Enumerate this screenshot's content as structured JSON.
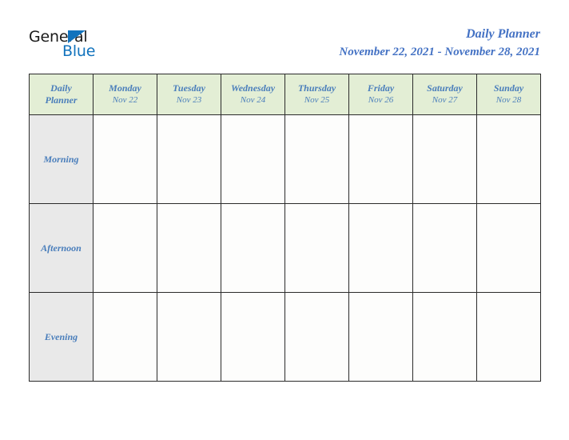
{
  "logo": {
    "word_one": "General",
    "word_two": "Blue",
    "triangle_icon": "triangle-icon",
    "word_one_color": "#1a1a1a",
    "word_two_color": "#1273bd"
  },
  "header": {
    "title": "Daily Planner",
    "date_range": "November 22, 2021 - November 28, 2021",
    "title_color": "#4472c4"
  },
  "table": {
    "corner_label_line1": "Daily",
    "corner_label_line2": "Planner",
    "header_bg": "#e3eed5",
    "row_label_bg": "#e9e9e9",
    "cell_bg": "#fdfdfc",
    "border_color": "#2b2b2b",
    "text_color": "#4a7ebb",
    "columns": [
      {
        "day": "Monday",
        "date": "Nov 22"
      },
      {
        "day": "Tuesday",
        "date": "Nov 23"
      },
      {
        "day": "Wednesday",
        "date": "Nov 24"
      },
      {
        "day": "Thursday",
        "date": "Nov 25"
      },
      {
        "day": "Friday",
        "date": "Nov 26"
      },
      {
        "day": "Saturday",
        "date": "Nov 27"
      },
      {
        "day": "Sunday",
        "date": "Nov 28"
      }
    ],
    "rows": [
      {
        "label": "Morning",
        "cells": [
          "",
          "",
          "",
          "",
          "",
          "",
          ""
        ]
      },
      {
        "label": "Afternoon",
        "cells": [
          "",
          "",
          "",
          "",
          "",
          "",
          ""
        ]
      },
      {
        "label": "Evening",
        "cells": [
          "",
          "",
          "",
          "",
          "",
          "",
          ""
        ]
      }
    ]
  }
}
